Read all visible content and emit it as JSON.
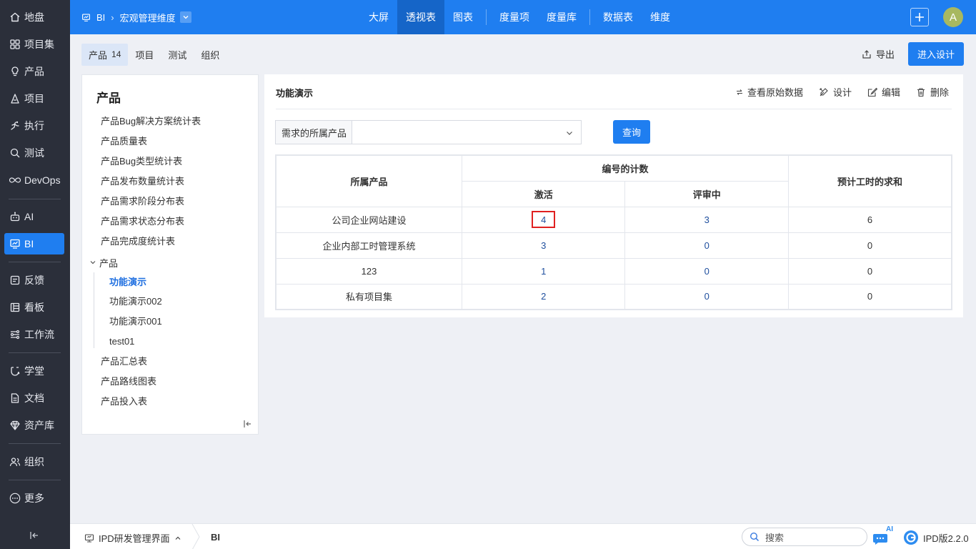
{
  "leftnav": {
    "items": [
      {
        "label": "地盘",
        "icon": "home-icon"
      },
      {
        "label": "项目集",
        "icon": "grid-icon"
      },
      {
        "label": "产品",
        "icon": "lightbulb-icon"
      },
      {
        "label": "项目",
        "icon": "project-icon"
      },
      {
        "label": "执行",
        "icon": "run-icon"
      },
      {
        "label": "测试",
        "icon": "test-icon"
      },
      {
        "label": "DevOps",
        "icon": "infinity-icon"
      },
      {
        "label": "AI",
        "icon": "robot-icon"
      },
      {
        "label": "BI",
        "icon": "chart-board-icon"
      },
      {
        "label": "反馈",
        "icon": "feedback-icon"
      },
      {
        "label": "看板",
        "icon": "kanban-icon"
      },
      {
        "label": "工作流",
        "icon": "workflow-icon"
      },
      {
        "label": "学堂",
        "icon": "school-icon"
      },
      {
        "label": "文档",
        "icon": "document-icon"
      },
      {
        "label": "资产库",
        "icon": "diamond-icon"
      },
      {
        "label": "组织",
        "icon": "people-icon"
      },
      {
        "label": "更多",
        "icon": "more-icon"
      }
    ],
    "active": "BI"
  },
  "topbar": {
    "crumb_root": "BI",
    "crumb_current": "宏观管理维度",
    "nav": [
      "大屏",
      "透视表",
      "图表",
      "度量项",
      "度量库",
      "数据表",
      "维度"
    ],
    "active_nav": "透视表",
    "avatar": "A"
  },
  "subtabs": {
    "items": [
      {
        "label": "产品",
        "count": "14"
      },
      {
        "label": "项目",
        "count": ""
      },
      {
        "label": "测试",
        "count": ""
      },
      {
        "label": "组织",
        "count": ""
      }
    ],
    "export_label": "导出",
    "enter_design_label": "进入设计"
  },
  "sidepanel": {
    "title": "产品",
    "items": [
      "产品Bug解决方案统计表",
      "产品质量表",
      "产品Bug类型统计表",
      "产品发布数量统计表",
      "产品需求阶段分布表",
      "产品需求状态分布表",
      "产品完成度统计表"
    ],
    "group_label": "产品",
    "group_children": [
      "功能演示",
      "功能演示002",
      "功能演示001",
      "test01"
    ],
    "active_child": "功能演示",
    "items_after": [
      "产品汇总表",
      "产品路线图表",
      "产品投入表"
    ]
  },
  "main": {
    "title": "功能演示",
    "actions": {
      "view_raw": "查看原始数据",
      "design": "设计",
      "edit": "编辑",
      "delete": "删除"
    },
    "filter": {
      "label": "需求的所属产品",
      "value": "",
      "query_label": "查询"
    },
    "table": {
      "header_product": "所属产品",
      "header_count_group": "编号的计数",
      "header_active": "激活",
      "header_reviewing": "评审中",
      "header_sum": "预计工时的求和",
      "rows": [
        {
          "product": "公司企业网站建设",
          "active": "4",
          "reviewing": "3",
          "sum": "6"
        },
        {
          "product": "企业内部工时管理系统",
          "active": "3",
          "reviewing": "0",
          "sum": "0"
        },
        {
          "product": "123",
          "active": "1",
          "reviewing": "0",
          "sum": "0"
        },
        {
          "product": "私有项目集",
          "active": "2",
          "reviewing": "0",
          "sum": "0"
        }
      ]
    }
  },
  "bottombar": {
    "app_label": "IPD研发管理界面",
    "crumb": "BI",
    "search_placeholder": "搜索",
    "ai_badge": "AI",
    "version": "IPD版2.2.0"
  },
  "colors": {
    "accent": "#1f7ef0",
    "nav_bg": "#2b2f3a",
    "highlight_border": "#e02020",
    "link_number": "#1f4f9e"
  }
}
